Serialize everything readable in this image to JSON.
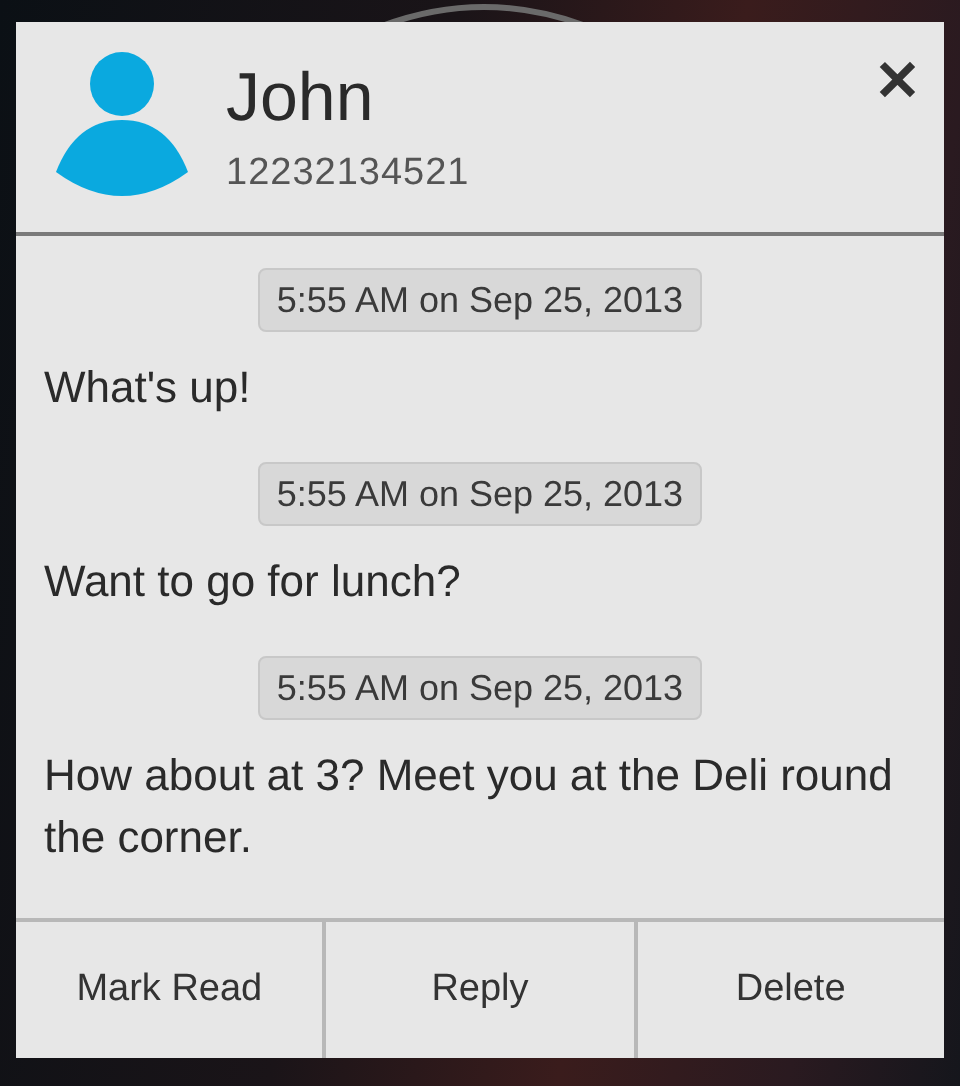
{
  "contact": {
    "name": "John",
    "number": "12232134521"
  },
  "close": {
    "label": "✕"
  },
  "messages": [
    {
      "timestamp": "5:55 AM on Sep 25, 2013",
      "text": "What's up!"
    },
    {
      "timestamp": "5:55 AM on Sep 25, 2013",
      "text": "Want to go for lunch?"
    },
    {
      "timestamp": "5:55 AM on Sep 25, 2013",
      "text": "How about at 3? Meet you at the Deli round the corner."
    }
  ],
  "buttons": [
    "Mark Read",
    "Reply",
    "Delete"
  ]
}
